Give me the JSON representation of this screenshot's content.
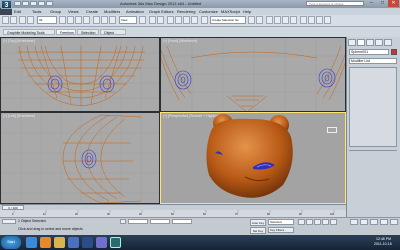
{
  "app": {
    "logo_text": "3",
    "title": "Autodesk 3ds Max Design 2012 x64 - Untitled",
    "search_placeholder": "Type a keyword or phrase"
  },
  "window_controls": {
    "minimize": "–",
    "maximize": "□",
    "close": "✕"
  },
  "menu": [
    "Edit",
    "Tools",
    "Group",
    "Views",
    "Create",
    "Modifiers",
    "Animation",
    "Graph Editors",
    "Rendering",
    "Customize",
    "MAXScript",
    "Help"
  ],
  "toolbar": {
    "selection_filter": "All",
    "reference_coord": "View",
    "named_selection": "Create Selection Se"
  },
  "ribbon_tabs": [
    "Graphite Modeling Tools",
    "Freeform",
    "Selection",
    "Object Paint"
  ],
  "viewports": {
    "top": "[+] [Top] [Wireframe]",
    "front": "[+] [Front] [Wireframe]",
    "left": "[+] [Left] [Wireframe]",
    "perspective": "[+] [Perspective] [Smooth + Highlights]"
  },
  "command_panel": {
    "object_name": "Sphere001",
    "modifier_list": "Modifier List"
  },
  "timeline": {
    "frame_counter": "0 / 100",
    "ticks": [
      "0",
      "10",
      "20",
      "30",
      "40",
      "50",
      "60",
      "70",
      "80",
      "90",
      "100"
    ]
  },
  "status": {
    "object_count": "1 Object Selected",
    "prompt": "Click and drag to select and move objects",
    "auto_key": "Auto Key",
    "set_key": "Set Key",
    "selected_label": "Selected",
    "key_filters": "Key Filters..."
  },
  "taskbar": {
    "start": "Start",
    "time": "12:48 PM",
    "date": "2011-10-16"
  },
  "colors": {
    "accent": "#ffe36e",
    "model_orange": "#b85a16",
    "eye_blue": "#3b3fd0",
    "viewport_bg": "#a9a9a9"
  }
}
